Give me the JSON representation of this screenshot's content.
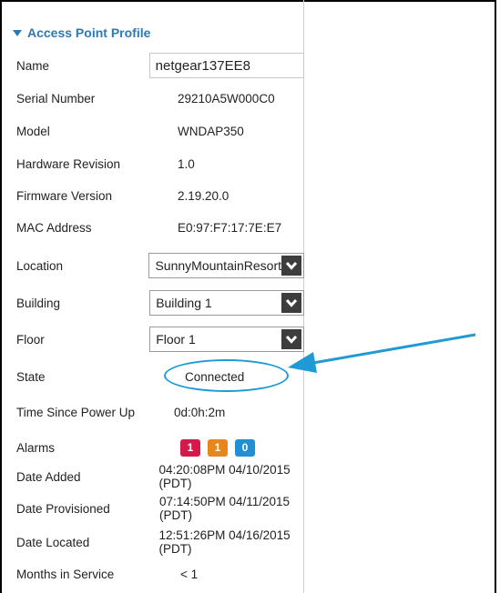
{
  "profile": {
    "title": "Access Point Profile",
    "name_label": "Name",
    "name_value": "netgear137EE8",
    "serial_label": "Serial Number",
    "serial_value": "29210A5W000C0",
    "model_label": "Model",
    "model_value": "WNDAP350",
    "hw_label": "Hardware Revision",
    "hw_value": "1.0",
    "fw_label": "Firmware Version",
    "fw_value": "2.19.20.0",
    "mac_label": "MAC Address",
    "mac_value": "E0:97:F7:17:7E:E7",
    "location_label": "Location",
    "location_value": "SunnyMountainResort",
    "building_label": "Building",
    "building_value": "Building 1",
    "floor_label": "Floor",
    "floor_value": "Floor 1",
    "state_label": "State",
    "state_value": "Connected",
    "uptime_label": "Time Since Power Up",
    "uptime_value": "0d:0h:2m",
    "alarms_label": "Alarms",
    "alarms": [
      {
        "count": "1",
        "color": "#d6194a"
      },
      {
        "count": "1",
        "color": "#e8861a"
      },
      {
        "count": "0",
        "color": "#1f8fd6"
      }
    ],
    "date_added_label": "Date Added",
    "date_added_value": "04:20:08PM 04/10/2015 (PDT)",
    "date_provisioned_label": "Date Provisioned",
    "date_provisioned_value": "07:14:50PM 04/11/2015 (PDT)",
    "date_located_label": "Date Located",
    "date_located_value": "12:51:26PM 04/16/2015 (PDT)",
    "months_label": "Months in Service",
    "months_value": "< 1"
  },
  "icons": {
    "section": "triangle-down-icon",
    "dropdown": "chevron-down-icon",
    "callout": "arrow-icon"
  },
  "colors": {
    "accent": "#2a7ab8",
    "callout": "#1f9ad6"
  }
}
